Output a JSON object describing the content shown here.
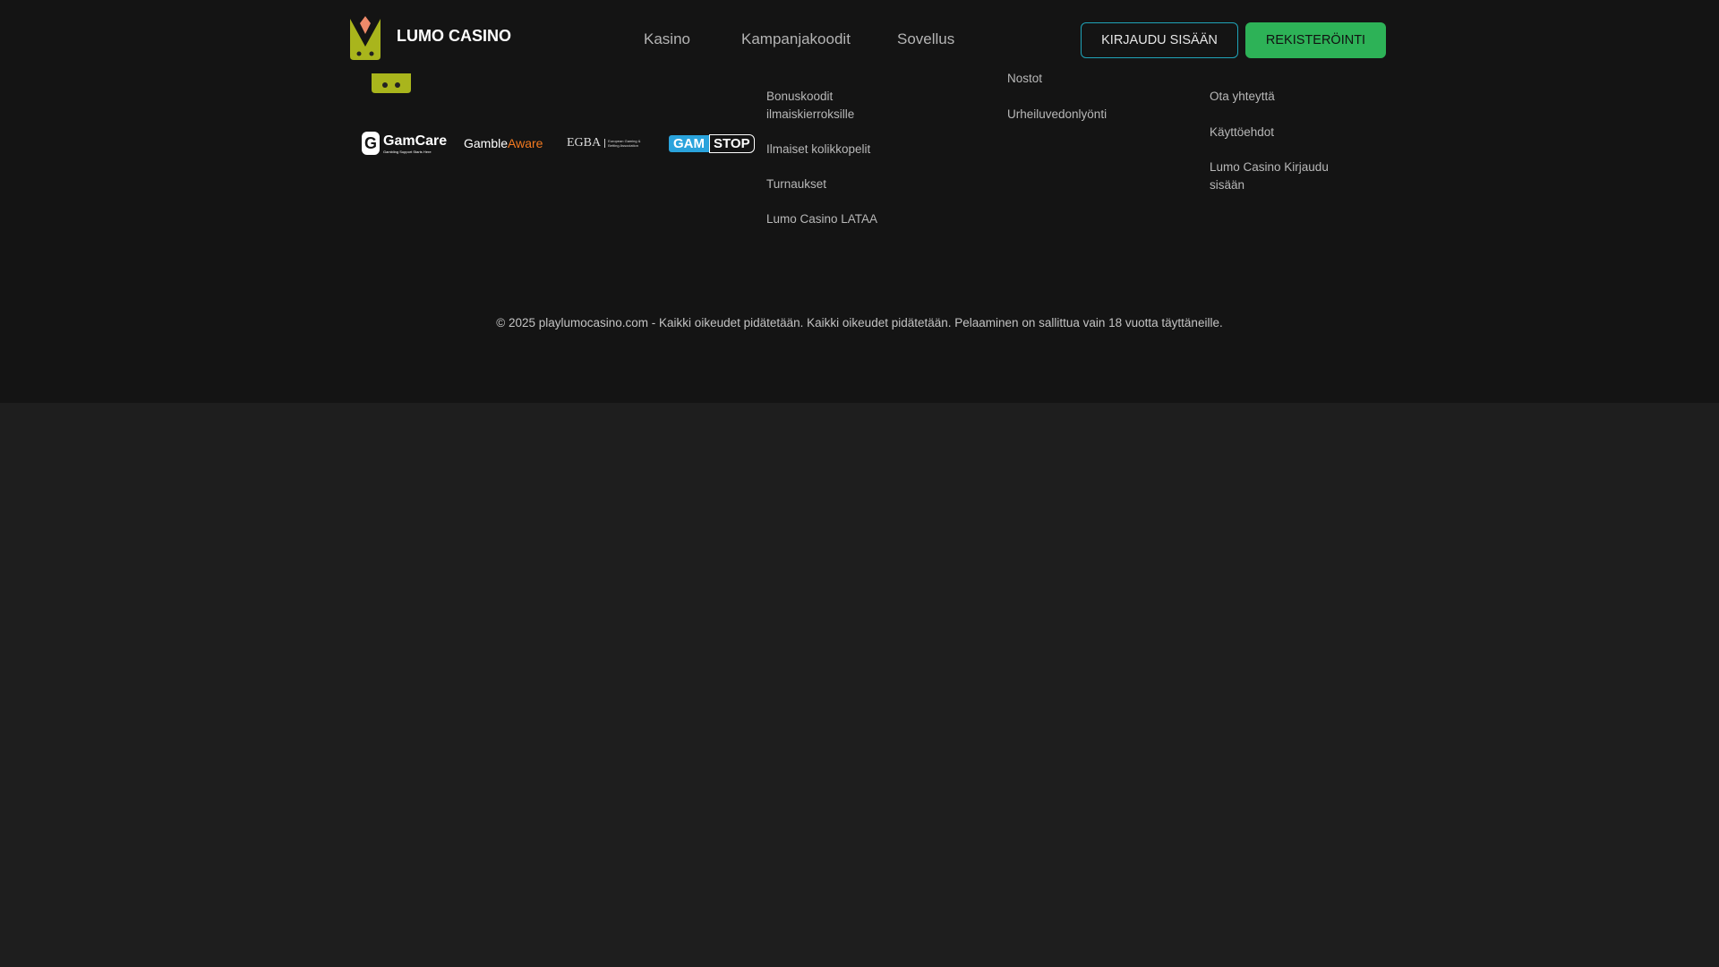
{
  "header": {
    "brand": "LUMO CASINO",
    "nav": [
      "Kasino",
      "Kampanjakoodit",
      "Sovellus"
    ],
    "login": "KIRJAUDU SISÄÄN",
    "register": "REKISTERÖINTI"
  },
  "badges": {
    "gamcare": "GamCare",
    "gamcare_sub": "Gambling Support Starts Here",
    "gambleaware_a": "Gamble",
    "gambleaware_b": "Aware",
    "egba": "EGBA",
    "egba_sub": "European Gaming & Betting Association",
    "gamstop_a": "GAM",
    "gamstop_b": "STOP"
  },
  "footer": {
    "col1": [
      "Bonuskoodit ilmaiskierroksille",
      "Ilmaiset kolikkopelit",
      "Turnaukset",
      "Lumo Casino LATAA"
    ],
    "col2": [
      "Nostot",
      "Urheiluvedonlyönti"
    ],
    "col3": [
      "Ota yhteyttä",
      "Käyttöehdot",
      "Lumo Casino Kirjaudu sisään"
    ],
    "copyright": "© 2025 playlumocasino.com - Kaikki oikeudet pidätetään. Kaikki oikeudet pidätetään. Pelaaminen on sallittua vain 18 vuotta täyttäneille."
  }
}
